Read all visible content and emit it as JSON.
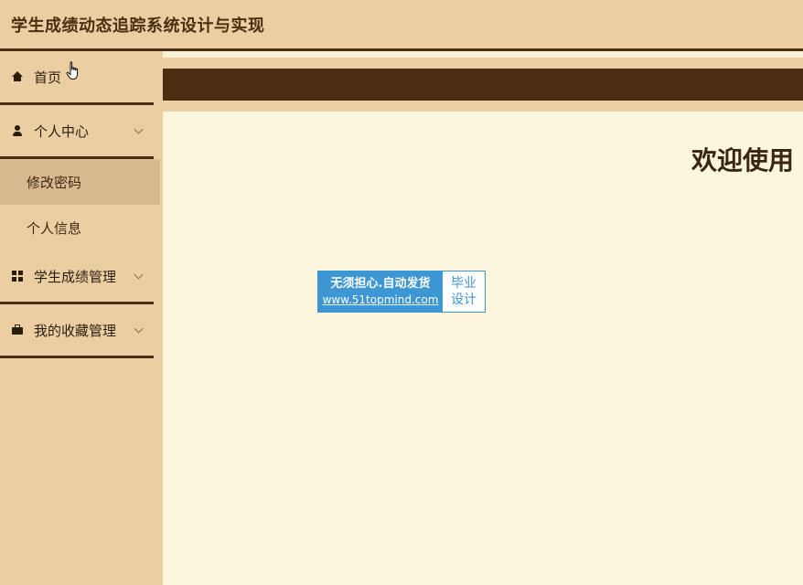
{
  "app": {
    "title": "学生成绩动态追踪系统设计与实现"
  },
  "sidebar": {
    "items": [
      {
        "label": "首页",
        "icon": "home-icon"
      },
      {
        "label": "个人中心",
        "icon": "user-icon",
        "expanded": true,
        "children": [
          {
            "label": "修改密码",
            "active": true
          },
          {
            "label": "个人信息",
            "active": false
          }
        ]
      },
      {
        "label": "学生成绩管理",
        "icon": "grid-icon"
      },
      {
        "label": "我的收藏管理",
        "icon": "briefcase-icon"
      }
    ]
  },
  "main": {
    "welcome": "欢迎使用"
  },
  "watermark": {
    "line1": "无须担心.自动发货",
    "line2": "www.51topmind.com",
    "right_line1": "毕业",
    "right_line2": "设计"
  },
  "colors": {
    "header_bg": "#ebcea1",
    "dark_brown": "#4b2e12",
    "content_bg": "#fdf6df",
    "active_sub_bg": "#d9b98f",
    "badge_blue": "#3c97d4"
  }
}
